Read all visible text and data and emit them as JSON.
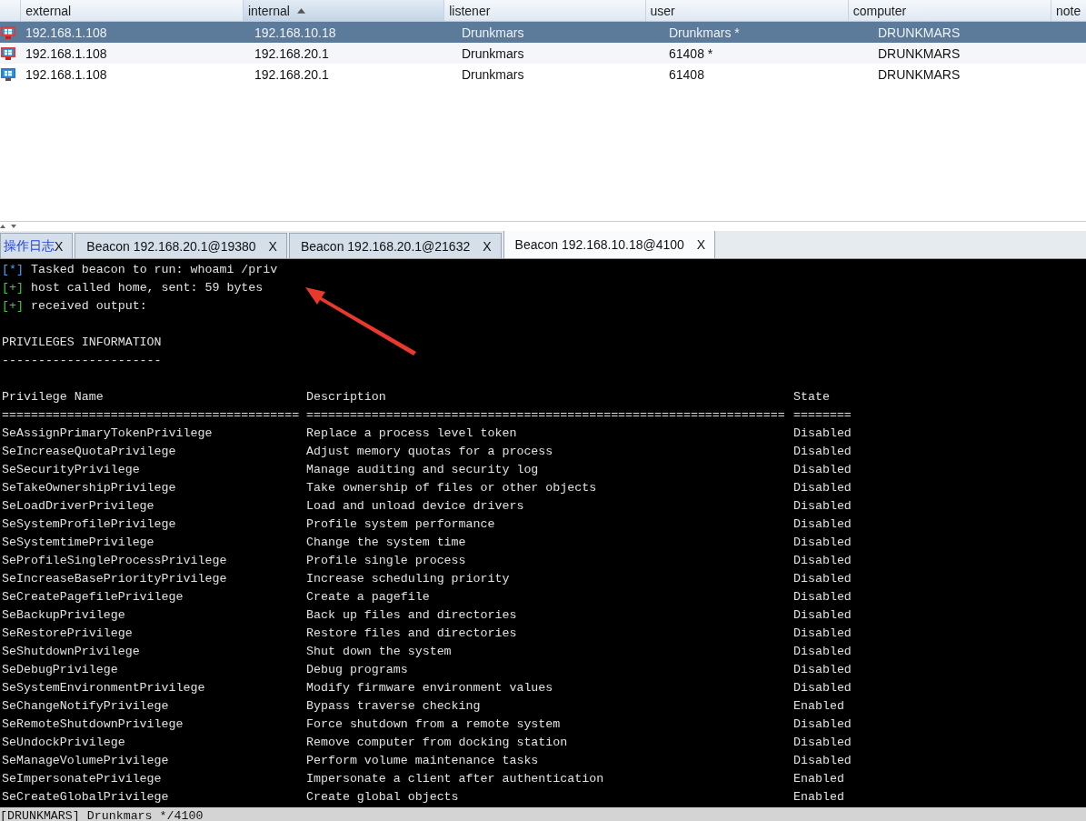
{
  "sessions": {
    "columns": [
      {
        "label": "external",
        "sorted": false
      },
      {
        "label": "internal",
        "sorted": true
      },
      {
        "label": "listener",
        "sorted": false
      },
      {
        "label": "user",
        "sorted": false
      },
      {
        "label": "computer",
        "sorted": false
      },
      {
        "label": "note",
        "sorted": false
      }
    ],
    "rows": [
      {
        "selected": true,
        "flagged": true,
        "cells": [
          "192.168.1.108",
          "192.168.10.18",
          "Drunkmars",
          "Drunkmars *",
          "DRUNKMARS"
        ]
      },
      {
        "selected": false,
        "flagged": true,
        "cells": [
          "192.168.1.108",
          "192.168.20.1",
          "Drunkmars",
          "61408 *",
          "DRUNKMARS"
        ]
      },
      {
        "selected": false,
        "flagged": false,
        "cells": [
          "192.168.1.108",
          "192.168.20.1",
          "Drunkmars",
          "61408",
          "DRUNKMARS"
        ]
      }
    ]
  },
  "tabs": [
    {
      "kind": "log",
      "label": "操作日志",
      "close": "X",
      "selected": false
    },
    {
      "kind": "beacon",
      "label": "Beacon 192.168.20.1@19380",
      "close": "X",
      "selected": false
    },
    {
      "kind": "beacon",
      "label": "Beacon 192.168.20.1@21632",
      "close": "X",
      "selected": false
    },
    {
      "kind": "beacon",
      "label": "Beacon 192.168.10.18@4100",
      "close": "X",
      "selected": true
    }
  ],
  "console": {
    "lines": [
      {
        "kind": "task",
        "marker": "[*]",
        "text": "Tasked beacon to run: whoami /priv"
      },
      {
        "kind": "ok",
        "marker": "[+]",
        "text": "host called home, sent: 59 bytes"
      },
      {
        "kind": "ok",
        "marker": "[+]",
        "text": "received output:"
      },
      {
        "kind": "blank"
      },
      {
        "kind": "text",
        "text": "PRIVILEGES INFORMATION"
      },
      {
        "kind": "text",
        "text": "----------------------"
      },
      {
        "kind": "blank"
      }
    ],
    "privileges": {
      "header": [
        "Privilege Name",
        "Description",
        "State"
      ],
      "separator": [
        "=========================================",
        "==================================================================",
        "========"
      ],
      "rows": [
        [
          "SeAssignPrimaryTokenPrivilege",
          "Replace a process level token",
          "Disabled"
        ],
        [
          "SeIncreaseQuotaPrivilege",
          "Adjust memory quotas for a process",
          "Disabled"
        ],
        [
          "SeSecurityPrivilege",
          "Manage auditing and security log",
          "Disabled"
        ],
        [
          "SeTakeOwnershipPrivilege",
          "Take ownership of files or other objects",
          "Disabled"
        ],
        [
          "SeLoadDriverPrivilege",
          "Load and unload device drivers",
          "Disabled"
        ],
        [
          "SeSystemProfilePrivilege",
          "Profile system performance",
          "Disabled"
        ],
        [
          "SeSystemtimePrivilege",
          "Change the system time",
          "Disabled"
        ],
        [
          "SeProfileSingleProcessPrivilege",
          "Profile single process",
          "Disabled"
        ],
        [
          "SeIncreaseBasePriorityPrivilege",
          "Increase scheduling priority",
          "Disabled"
        ],
        [
          "SeCreatePagefilePrivilege",
          "Create a pagefile",
          "Disabled"
        ],
        [
          "SeBackupPrivilege",
          "Back up files and directories",
          "Disabled"
        ],
        [
          "SeRestorePrivilege",
          "Restore files and directories",
          "Disabled"
        ],
        [
          "SeShutdownPrivilege",
          "Shut down the system",
          "Disabled"
        ],
        [
          "SeDebugPrivilege",
          "Debug programs",
          "Disabled"
        ],
        [
          "SeSystemEnvironmentPrivilege",
          "Modify firmware environment values",
          "Disabled"
        ],
        [
          "SeChangeNotifyPrivilege",
          "Bypass traverse checking",
          "Enabled"
        ],
        [
          "SeRemoteShutdownPrivilege",
          "Force shutdown from a remote system",
          "Disabled"
        ],
        [
          "SeUndockPrivilege",
          "Remove computer from docking station",
          "Disabled"
        ],
        [
          "SeManageVolumePrivilege",
          "Perform volume maintenance tasks",
          "Disabled"
        ],
        [
          "SeImpersonatePrivilege",
          "Impersonate a client after authentication",
          "Enabled"
        ],
        [
          "SeCreateGlobalPrivilege",
          "Create global objects",
          "Enabled"
        ]
      ]
    }
  },
  "status_bar": "[DRUNKMARS] Drunkmars */4100"
}
